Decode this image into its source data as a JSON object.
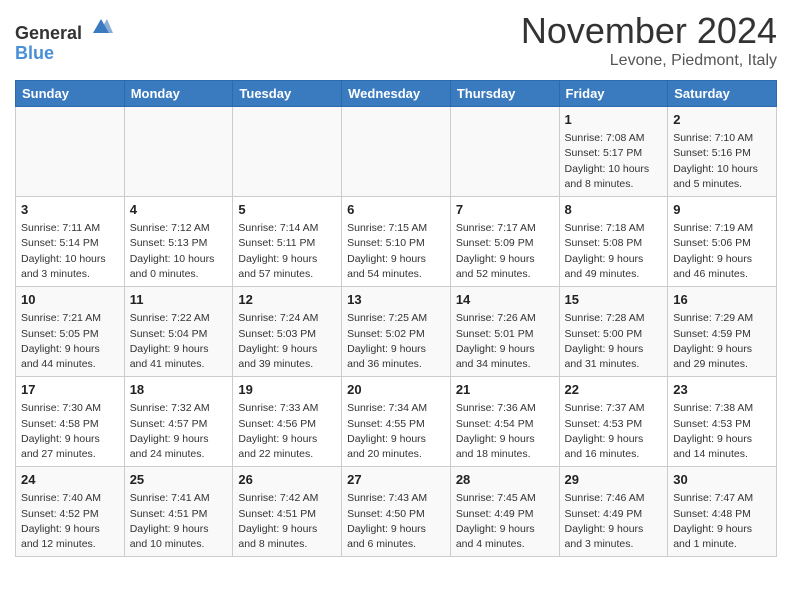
{
  "header": {
    "logo_general": "General",
    "logo_blue": "Blue",
    "month": "November 2024",
    "location": "Levone, Piedmont, Italy"
  },
  "days_of_week": [
    "Sunday",
    "Monday",
    "Tuesday",
    "Wednesday",
    "Thursday",
    "Friday",
    "Saturday"
  ],
  "weeks": [
    {
      "row_bg": "light",
      "days": [
        {
          "num": "",
          "info": ""
        },
        {
          "num": "",
          "info": ""
        },
        {
          "num": "",
          "info": ""
        },
        {
          "num": "",
          "info": ""
        },
        {
          "num": "",
          "info": ""
        },
        {
          "num": "1",
          "info": "Sunrise: 7:08 AM\nSunset: 5:17 PM\nDaylight: 10 hours\nand 8 minutes."
        },
        {
          "num": "2",
          "info": "Sunrise: 7:10 AM\nSunset: 5:16 PM\nDaylight: 10 hours\nand 5 minutes."
        }
      ]
    },
    {
      "row_bg": "dark",
      "days": [
        {
          "num": "3",
          "info": "Sunrise: 7:11 AM\nSunset: 5:14 PM\nDaylight: 10 hours\nand 3 minutes."
        },
        {
          "num": "4",
          "info": "Sunrise: 7:12 AM\nSunset: 5:13 PM\nDaylight: 10 hours\nand 0 minutes."
        },
        {
          "num": "5",
          "info": "Sunrise: 7:14 AM\nSunset: 5:11 PM\nDaylight: 9 hours\nand 57 minutes."
        },
        {
          "num": "6",
          "info": "Sunrise: 7:15 AM\nSunset: 5:10 PM\nDaylight: 9 hours\nand 54 minutes."
        },
        {
          "num": "7",
          "info": "Sunrise: 7:17 AM\nSunset: 5:09 PM\nDaylight: 9 hours\nand 52 minutes."
        },
        {
          "num": "8",
          "info": "Sunrise: 7:18 AM\nSunset: 5:08 PM\nDaylight: 9 hours\nand 49 minutes."
        },
        {
          "num": "9",
          "info": "Sunrise: 7:19 AM\nSunset: 5:06 PM\nDaylight: 9 hours\nand 46 minutes."
        }
      ]
    },
    {
      "row_bg": "light",
      "days": [
        {
          "num": "10",
          "info": "Sunrise: 7:21 AM\nSunset: 5:05 PM\nDaylight: 9 hours\nand 44 minutes."
        },
        {
          "num": "11",
          "info": "Sunrise: 7:22 AM\nSunset: 5:04 PM\nDaylight: 9 hours\nand 41 minutes."
        },
        {
          "num": "12",
          "info": "Sunrise: 7:24 AM\nSunset: 5:03 PM\nDaylight: 9 hours\nand 39 minutes."
        },
        {
          "num": "13",
          "info": "Sunrise: 7:25 AM\nSunset: 5:02 PM\nDaylight: 9 hours\nand 36 minutes."
        },
        {
          "num": "14",
          "info": "Sunrise: 7:26 AM\nSunset: 5:01 PM\nDaylight: 9 hours\nand 34 minutes."
        },
        {
          "num": "15",
          "info": "Sunrise: 7:28 AM\nSunset: 5:00 PM\nDaylight: 9 hours\nand 31 minutes."
        },
        {
          "num": "16",
          "info": "Sunrise: 7:29 AM\nSunset: 4:59 PM\nDaylight: 9 hours\nand 29 minutes."
        }
      ]
    },
    {
      "row_bg": "dark",
      "days": [
        {
          "num": "17",
          "info": "Sunrise: 7:30 AM\nSunset: 4:58 PM\nDaylight: 9 hours\nand 27 minutes."
        },
        {
          "num": "18",
          "info": "Sunrise: 7:32 AM\nSunset: 4:57 PM\nDaylight: 9 hours\nand 24 minutes."
        },
        {
          "num": "19",
          "info": "Sunrise: 7:33 AM\nSunset: 4:56 PM\nDaylight: 9 hours\nand 22 minutes."
        },
        {
          "num": "20",
          "info": "Sunrise: 7:34 AM\nSunset: 4:55 PM\nDaylight: 9 hours\nand 20 minutes."
        },
        {
          "num": "21",
          "info": "Sunrise: 7:36 AM\nSunset: 4:54 PM\nDaylight: 9 hours\nand 18 minutes."
        },
        {
          "num": "22",
          "info": "Sunrise: 7:37 AM\nSunset: 4:53 PM\nDaylight: 9 hours\nand 16 minutes."
        },
        {
          "num": "23",
          "info": "Sunrise: 7:38 AM\nSunset: 4:53 PM\nDaylight: 9 hours\nand 14 minutes."
        }
      ]
    },
    {
      "row_bg": "light",
      "days": [
        {
          "num": "24",
          "info": "Sunrise: 7:40 AM\nSunset: 4:52 PM\nDaylight: 9 hours\nand 12 minutes."
        },
        {
          "num": "25",
          "info": "Sunrise: 7:41 AM\nSunset: 4:51 PM\nDaylight: 9 hours\nand 10 minutes."
        },
        {
          "num": "26",
          "info": "Sunrise: 7:42 AM\nSunset: 4:51 PM\nDaylight: 9 hours\nand 8 minutes."
        },
        {
          "num": "27",
          "info": "Sunrise: 7:43 AM\nSunset: 4:50 PM\nDaylight: 9 hours\nand 6 minutes."
        },
        {
          "num": "28",
          "info": "Sunrise: 7:45 AM\nSunset: 4:49 PM\nDaylight: 9 hours\nand 4 minutes."
        },
        {
          "num": "29",
          "info": "Sunrise: 7:46 AM\nSunset: 4:49 PM\nDaylight: 9 hours\nand 3 minutes."
        },
        {
          "num": "30",
          "info": "Sunrise: 7:47 AM\nSunset: 4:48 PM\nDaylight: 9 hours\nand 1 minute."
        }
      ]
    }
  ]
}
